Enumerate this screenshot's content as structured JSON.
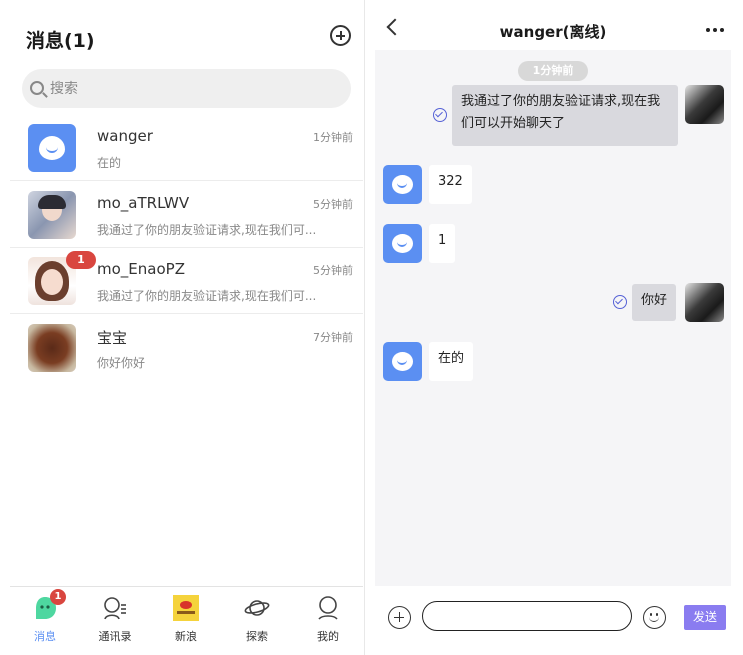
{
  "messages_page": {
    "title": "消息(1)",
    "search_placeholder": "搜索",
    "conversations": [
      {
        "name": "wanger",
        "preview": "在的",
        "time": "1分钟前",
        "badge": ""
      },
      {
        "name": "mo_aTRLWV",
        "preview": "我通过了你的朋友验证请求,现在我们可...",
        "time": "5分钟前",
        "badge": ""
      },
      {
        "name": "mo_EnaoPZ",
        "preview": "我通过了你的朋友验证请求,现在我们可...",
        "time": "5分钟前",
        "badge": "1"
      },
      {
        "name": "宝宝",
        "preview": "你好你好",
        "time": "7分钟前",
        "badge": ""
      }
    ],
    "tabs": [
      {
        "label": "消息",
        "icon": "chat-icon",
        "badge": "1",
        "active": true
      },
      {
        "label": "通讯录",
        "icon": "contacts-icon"
      },
      {
        "label": "新浪",
        "icon": "sina-icon"
      },
      {
        "label": "探索",
        "icon": "planet-icon"
      },
      {
        "label": "我的",
        "icon": "profile-icon"
      }
    ]
  },
  "chat": {
    "title": "wanger(离线)",
    "timestamp": "1分钟前",
    "messages": [
      {
        "direction": "out",
        "text": "我通过了你的朋友验证请求,现在我们可以开始聊天了",
        "line1": "我通过了你的朋友验证请求,现在我",
        "line2": "们可以开始聊天了"
      },
      {
        "direction": "in",
        "text": "322"
      },
      {
        "direction": "in",
        "text": "1"
      },
      {
        "direction": "out",
        "text": "你好"
      },
      {
        "direction": "in",
        "text": "在的"
      }
    ],
    "input_value": "",
    "send_label": "发送"
  },
  "colors": {
    "accent": "#5b8ff2",
    "badge": "#d9463f",
    "send": "#8a7cf0",
    "check": "#5561d6"
  }
}
